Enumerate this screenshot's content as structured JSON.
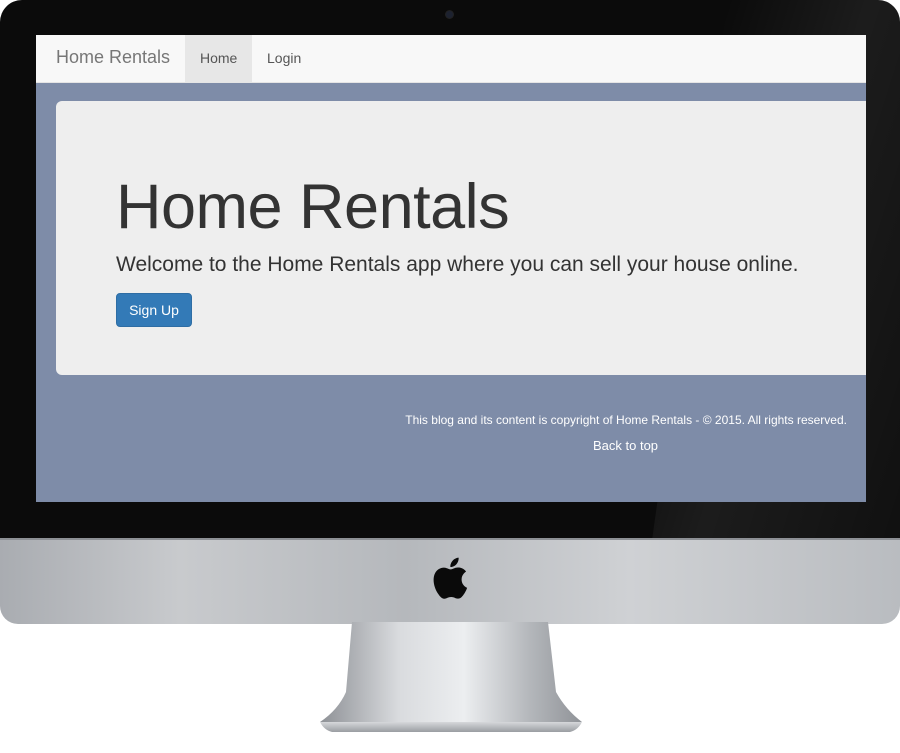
{
  "navbar": {
    "brand": "Home Rentals",
    "items": [
      {
        "label": "Home",
        "active": true
      },
      {
        "label": "Login",
        "active": false
      }
    ]
  },
  "jumbotron": {
    "title": "Home Rentals",
    "lead": "Welcome to the Home Rentals app where you can sell your house online.",
    "signup_label": "Sign Up"
  },
  "footer": {
    "copyright": "This blog and its content is copyright of Home Rentals - © 2015. All rights reserved.",
    "back_to_top": "Back to top"
  },
  "colors": {
    "page_background": "#7e8ca8",
    "navbar_background": "#f8f8f8",
    "jumbotron_background": "#eeeeee",
    "primary_button": "#337ab7"
  },
  "icons": {
    "device_logo": "apple-icon"
  }
}
